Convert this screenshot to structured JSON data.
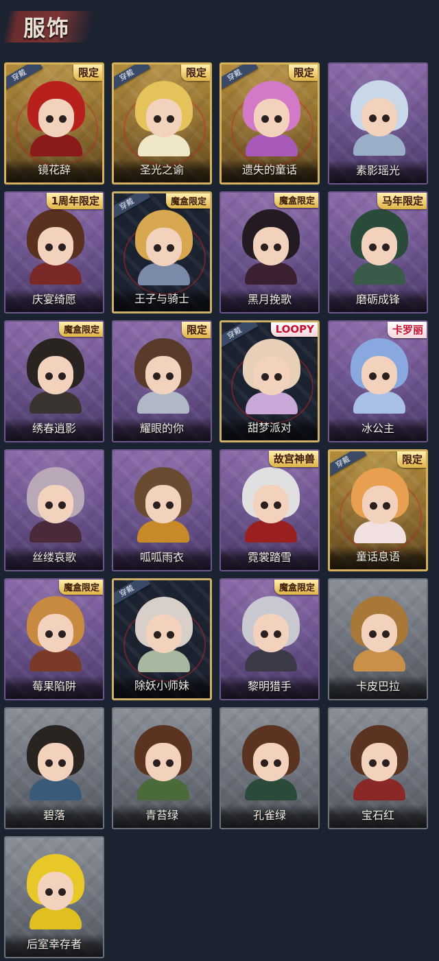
{
  "page": {
    "title": "服饰"
  },
  "badges": {
    "wear": "穿戴"
  },
  "costumes": [
    {
      "name": "镜花辞",
      "tag": "限定",
      "tag_style": "limited",
      "worn": true,
      "frame": "gold",
      "hair": "#b8201e",
      "body": "#8b1a1a"
    },
    {
      "name": "圣光之谕",
      "tag": "限定",
      "tag_style": "limited",
      "worn": true,
      "frame": "gold",
      "hair": "#e6c35a",
      "body": "#f0e6c8"
    },
    {
      "name": "遗失的童话",
      "tag": "限定",
      "tag_style": "limited",
      "worn": true,
      "frame": "gold",
      "hair": "#d27ac8",
      "body": "#a85ab8"
    },
    {
      "name": "素影瑶光",
      "tag": "",
      "tag_style": "",
      "worn": false,
      "frame": "purple",
      "hair": "#c8d8e8",
      "body": "#9ab0c8"
    },
    {
      "name": "庆宴绮愿",
      "tag": "1周年限定",
      "tag_style": "limited",
      "worn": false,
      "frame": "purple",
      "hair": "#5a3020",
      "body": "#7a2828"
    },
    {
      "name": "王子与骑士",
      "tag": "魔盒限定",
      "tag_style": "box",
      "worn": true,
      "frame": "framed",
      "hair": "#d8a850",
      "body": "#7a8aa8"
    },
    {
      "name": "黑月挽歌",
      "tag": "魔盒限定",
      "tag_style": "box",
      "worn": false,
      "frame": "purple",
      "hair": "#241a22",
      "body": "#3a2030"
    },
    {
      "name": "磨砺成锋",
      "tag": "马年限定",
      "tag_style": "limited",
      "worn": false,
      "frame": "purple",
      "hair": "#2a4a3a",
      "body": "#3a5a4a"
    },
    {
      "name": "绣春逍影",
      "tag": "魔盒限定",
      "tag_style": "box",
      "worn": false,
      "frame": "purple",
      "hair": "#2a2420",
      "body": "#3a3430"
    },
    {
      "name": "耀眼的你",
      "tag": "限定",
      "tag_style": "limited",
      "worn": false,
      "frame": "purple",
      "hair": "#5a3a2a",
      "body": "#b0b8c8"
    },
    {
      "name": "甜梦派对",
      "tag": "LOOPY",
      "tag_style": "red",
      "worn": true,
      "frame": "framed",
      "hair": "#e8d0b8",
      "body": "#c8a8d8"
    },
    {
      "name": "冰公主",
      "tag": "卡罗丽",
      "tag_style": "red",
      "worn": false,
      "frame": "purple",
      "hair": "#8aa8e0",
      "body": "#a8c0e8"
    },
    {
      "name": "丝缕哀歌",
      "tag": "",
      "tag_style": "",
      "worn": false,
      "frame": "purple",
      "hair": "#b8a8b8",
      "body": "#4a2a3a"
    },
    {
      "name": "呱呱雨衣",
      "tag": "",
      "tag_style": "",
      "worn": false,
      "frame": "purple",
      "hair": "#6a4a30",
      "body": "#c88a28"
    },
    {
      "name": "霓裳踏雪",
      "tag": "故宫神兽",
      "tag_style": "limited",
      "worn": false,
      "frame": "purple",
      "hair": "#e0e0e0",
      "body": "#9a2020"
    },
    {
      "name": "童话息语",
      "tag": "限定",
      "tag_style": "limited",
      "worn": true,
      "frame": "gold",
      "hair": "#e8a050",
      "body": "#f0e0e0"
    },
    {
      "name": "莓果陷阱",
      "tag": "魔盒限定",
      "tag_style": "box",
      "worn": false,
      "frame": "purple",
      "hair": "#c88a40",
      "body": "#7a3a28"
    },
    {
      "name": "除妖小师妹",
      "tag": "",
      "tag_style": "",
      "worn": true,
      "frame": "framed",
      "hair": "#d8d0c8",
      "body": "#a8b8a0"
    },
    {
      "name": "黎明猎手",
      "tag": "魔盒限定",
      "tag_style": "box",
      "worn": false,
      "frame": "purple",
      "hair": "#c8c8d0",
      "body": "#3a3a48"
    },
    {
      "name": "卡皮巴拉",
      "tag": "",
      "tag_style": "",
      "worn": false,
      "frame": "gray",
      "hair": "#a87838",
      "body": "#c89048"
    },
    {
      "name": "碧落",
      "tag": "",
      "tag_style": "",
      "worn": false,
      "frame": "gray",
      "hair": "#2a2420",
      "body": "#3a5a7a"
    },
    {
      "name": "青苔绿",
      "tag": "",
      "tag_style": "",
      "worn": false,
      "frame": "gray",
      "hair": "#5a3420",
      "body": "#4a6a3a"
    },
    {
      "name": "孔雀绿",
      "tag": "",
      "tag_style": "",
      "worn": false,
      "frame": "gray",
      "hair": "#5a3420",
      "body": "#2a4a3a"
    },
    {
      "name": "宝石红",
      "tag": "",
      "tag_style": "",
      "worn": false,
      "frame": "gray",
      "hair": "#5a3420",
      "body": "#8a2828"
    },
    {
      "name": "后室幸存者",
      "tag": "",
      "tag_style": "",
      "worn": false,
      "frame": "gray",
      "hair": "#e8c828",
      "body": "#e0c020"
    }
  ]
}
